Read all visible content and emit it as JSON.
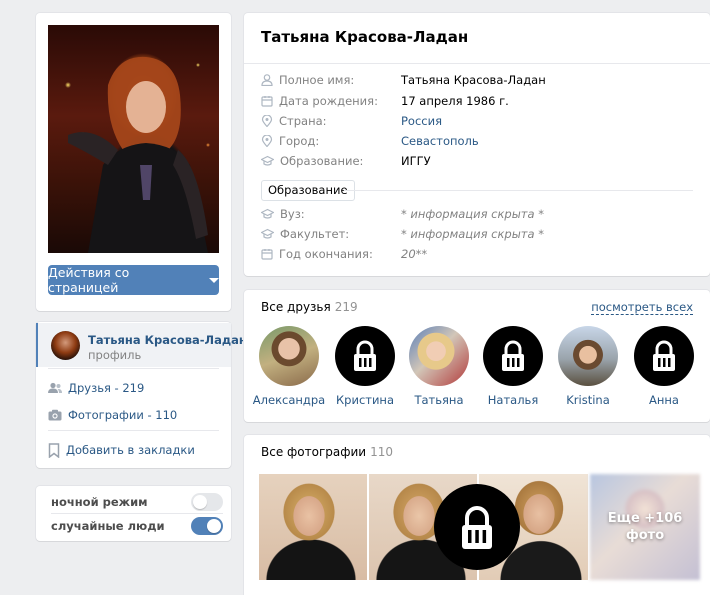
{
  "profile": {
    "name": "Татьяна Красова-Ладан",
    "actions_label": "Действия со страницей"
  },
  "mini": {
    "name": "Татьяна Красова-Ладан",
    "subtitle": "профиль",
    "friends_label": "Друзья - 219",
    "photos_label": "Фотографии - 110",
    "bookmark_label": "Добавить в закладки"
  },
  "toggles": {
    "night_mode": {
      "label": "ночной режим",
      "state": "off"
    },
    "random_people": {
      "label": "случайные люди",
      "state": "on"
    }
  },
  "info": {
    "fields": [
      {
        "label": "Полное имя:",
        "value": "Татьяна Красова-Ладан",
        "icon": "person-icon",
        "style": "plain"
      },
      {
        "label": "Дата рождения:",
        "value": "17 апреля 1986 г.",
        "icon": "calendar-icon",
        "style": "plain"
      },
      {
        "label": "Страна:",
        "value": "Россия",
        "icon": "location-pin-icon",
        "style": "link"
      },
      {
        "label": "Город:",
        "value": "Севастополь",
        "icon": "location-pin-icon",
        "style": "link"
      },
      {
        "label": "Образование:",
        "value": "ИГГУ",
        "icon": "graduation-cap-icon",
        "style": "plain"
      }
    ],
    "education_tag": "Образование",
    "education_fields": [
      {
        "label": "Вуз:",
        "value": "* информация скрыта *",
        "icon": "graduation-cap-icon",
        "style": "hidden"
      },
      {
        "label": "Факультет:",
        "value": "* информация скрыта *",
        "icon": "graduation-cap-icon",
        "style": "hidden"
      },
      {
        "label": "Год окончания:",
        "value": "20**",
        "icon": "calendar-icon",
        "style": "hidden"
      }
    ]
  },
  "friends": {
    "title": "Все друзья",
    "count": "219",
    "see_all": "посмотреть всех",
    "items": [
      {
        "name": "Александра",
        "locked": false
      },
      {
        "name": "Кристина",
        "locked": true
      },
      {
        "name": "Татьяна",
        "locked": false
      },
      {
        "name": "Наталья",
        "locked": true
      },
      {
        "name": "Kristina",
        "locked": false
      },
      {
        "name": "Анна",
        "locked": true
      }
    ]
  },
  "photos": {
    "title": "Все фотографии",
    "count": "110",
    "more_line1": "Еще +106",
    "more_line2": "фото"
  },
  "colors": {
    "accent": "#5181b8",
    "link": "#2a5885",
    "muted": "#828282",
    "page_bg": "#edeef0"
  }
}
